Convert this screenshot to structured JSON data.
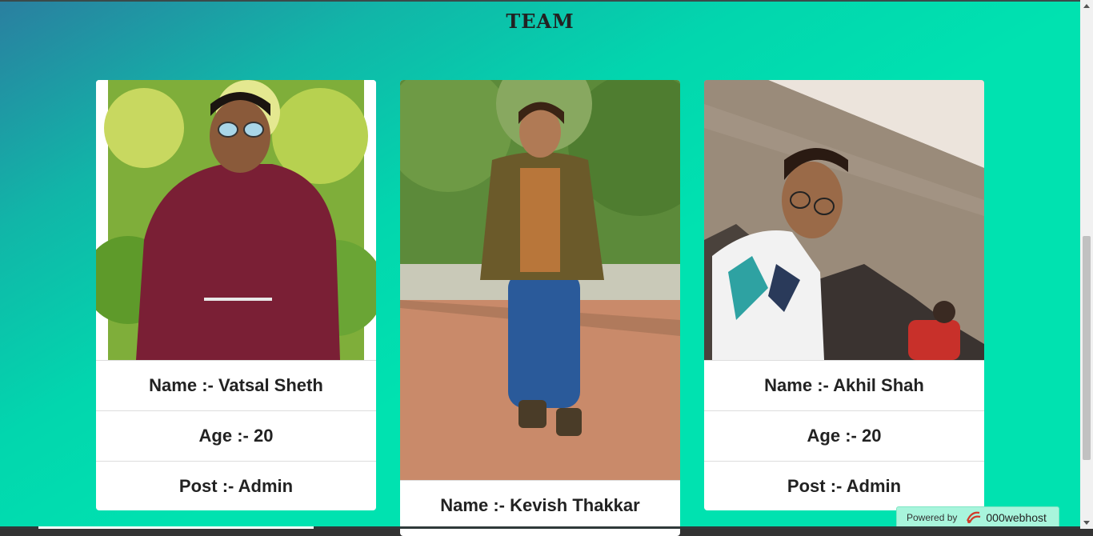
{
  "page": {
    "title": "TEAM"
  },
  "members": [
    {
      "name_label": "Name :- Vatsal Sheth",
      "age_label": "Age :- 20",
      "post_label": "Post :- Admin"
    },
    {
      "name_label": "Name :- Kevish Thakkar"
    },
    {
      "name_label": "Name :- Akhil Shah",
      "age_label": "Age :- 20",
      "post_label": "Post :- Admin"
    }
  ],
  "footer": {
    "powered_by": "Powered by",
    "brand": "000webhost",
    "logo_icon": "000webhost-logo-icon"
  },
  "colors": {
    "bg_start": "#2a7fa0",
    "bg_end": "#00e2b0",
    "card": "#ffffff"
  }
}
